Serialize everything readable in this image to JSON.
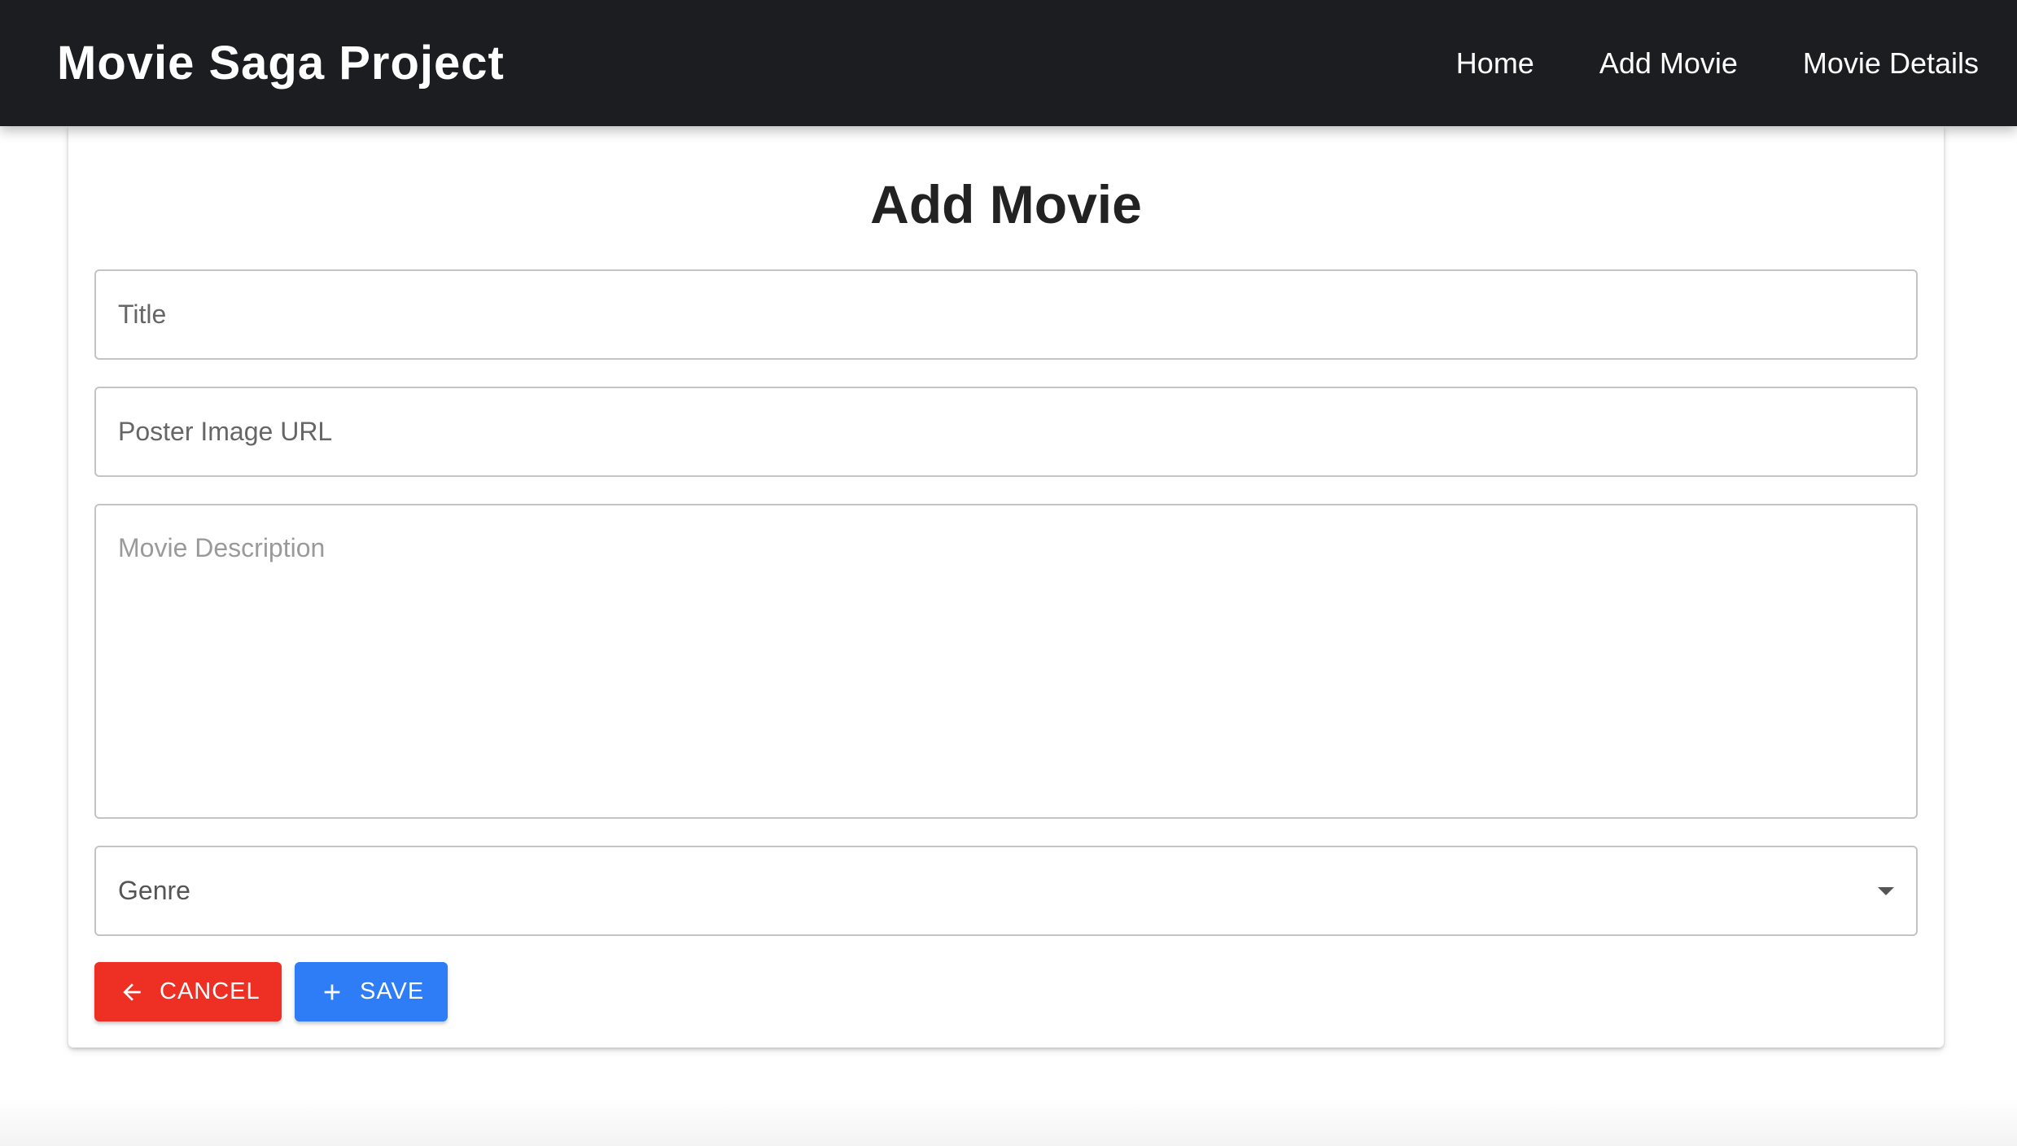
{
  "navbar": {
    "brand": "Movie Saga Project",
    "links": [
      "Home",
      "Add Movie",
      "Movie Details"
    ]
  },
  "form": {
    "heading": "Add Movie",
    "title_placeholder": "Title",
    "title_value": "",
    "poster_placeholder": "Poster Image URL",
    "poster_value": "",
    "description_placeholder": "Movie Description",
    "description_value": "",
    "genre_label": "Genre",
    "cancel_label": "CANCEL",
    "save_label": "SAVE"
  },
  "icons": {
    "cancel": "arrow-left-icon",
    "save": "plus-icon",
    "genre": "caret-down-icon"
  },
  "colors": {
    "navbar_bg": "#1c1d21",
    "cancel_bg": "#ee3024",
    "save_bg": "#2e7cf6"
  }
}
